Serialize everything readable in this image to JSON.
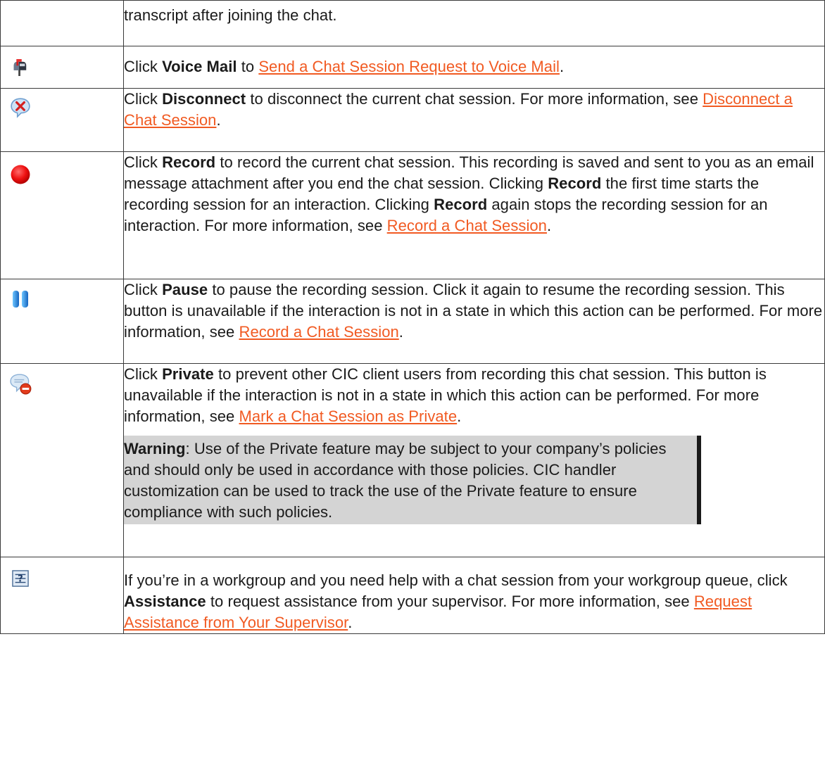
{
  "rows": [
    {
      "icon": "blank",
      "text": "transcript after joining the chat."
    },
    {
      "icon": "voicemail-mailbox-icon",
      "pre": "Click ",
      "bold": "Voice Mail",
      "mid": " to ",
      "link": "Send a Chat Session Request to Voice Mail",
      "post": "."
    },
    {
      "icon": "disconnect-icon",
      "pre": "Click ",
      "bold": "Disconnect",
      "mid": " to disconnect the current chat session. For more information, see ",
      "link": "Disconnect a Chat Session",
      "post": "."
    },
    {
      "icon": "record-icon",
      "pre": "Click ",
      "bold": "Record",
      "mid": " to record the current chat session. This recording is saved and sent to you as an email message attachment after you end the chat session. Clicking ",
      "bold2": "Record",
      "mid2": " the first time starts the recording session for an interaction. Clicking ",
      "bold3": "Record",
      "mid3": " again stops the recording session for an interaction. For more information, see ",
      "link": "Record a Chat Session",
      "post": "."
    },
    {
      "icon": "pause-icon",
      "pre": "Click ",
      "bold": "Pause",
      "mid": " to pause the recording session. Click it again to resume the recording session. This button is unavailable if the interaction is not in a state in which this action can be performed. For more information, see ",
      "link": "Record a Chat Session",
      "post": "."
    },
    {
      "icon": "private-icon",
      "pre": "Click ",
      "bold": "Private",
      "mid": " to prevent other CIC client users from recording this chat session. This button is unavailable if the interaction is not in a state in which this action can be performed. For more information, see ",
      "link": "Mark a Chat Session as Private",
      "post": ".",
      "warning_label": "Warning",
      "warning_text": ": Use of the Private feature may be subject to your company’s policies and should only be used in accordance with those policies. CIC handler customization can be used to track the use of the Private feature to ensure compliance with such policies."
    },
    {
      "icon": "assistance-icon",
      "pre": "If you’re in a workgroup and you need help with a chat session from your workgroup queue, click ",
      "bold": "Assistance",
      "mid": " to request assistance from your supervisor. For more information, see ",
      "link": "Request Assistance from Your Supervisor",
      "post": "."
    }
  ],
  "colors": {
    "link": "#f15a22",
    "warning_bg": "#d4d4d4",
    "border": "#3a3a3a"
  }
}
